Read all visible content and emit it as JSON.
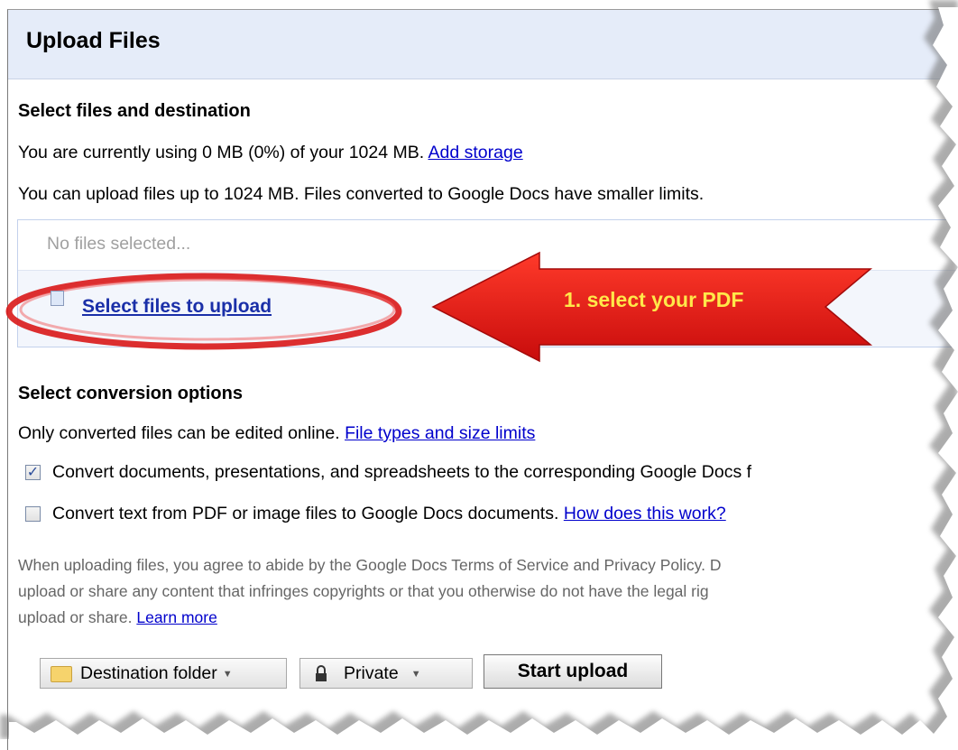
{
  "dialog": {
    "title": "Upload Files"
  },
  "files_section": {
    "heading": "Select files and destination",
    "storage_text": "You are currently using 0 MB (0%) of your 1024 MB.",
    "add_storage_link": "Add storage",
    "limit_text": "You can upload files up to 1024 MB. Files converted to Google Docs have smaller limits.",
    "no_files_text": "No files selected...",
    "select_files_link": "Select files to upload"
  },
  "annotation": {
    "text": "1. select your PDF",
    "arrow_color": "#e41411",
    "text_color": "#ffe84a"
  },
  "conversion_section": {
    "heading": "Select conversion options",
    "info_text": "Only converted files can be edited online.",
    "file_types_link": "File types and size limits",
    "options": [
      {
        "label": "Convert documents, presentations, and spreadsheets to the corresponding Google Docs f",
        "checked": true
      },
      {
        "label": "Convert text from PDF or image files to Google Docs documents.",
        "checked": false
      }
    ],
    "how_link": "How does this work?"
  },
  "legal": {
    "line1": "When uploading files, you agree to abide by the Google Docs Terms of Service and Privacy Policy. D",
    "line2": "upload or share any content that infringes copyrights or that you otherwise do not have the legal rig",
    "line3": "upload or share.",
    "learn_more_link": "Learn more"
  },
  "buttons": {
    "destination_folder": "Destination folder",
    "privacy": "Private",
    "start_upload": "Start upload"
  },
  "icons": {
    "folder": "folder-icon",
    "lock": "lock-icon",
    "file": "file-icon",
    "dropdown": "chevron-down-icon",
    "check": "checkmark-icon"
  },
  "colors": {
    "title_bar": "#e5ecf9",
    "link": "#0000cc",
    "file_box": "#f3f6fc"
  }
}
